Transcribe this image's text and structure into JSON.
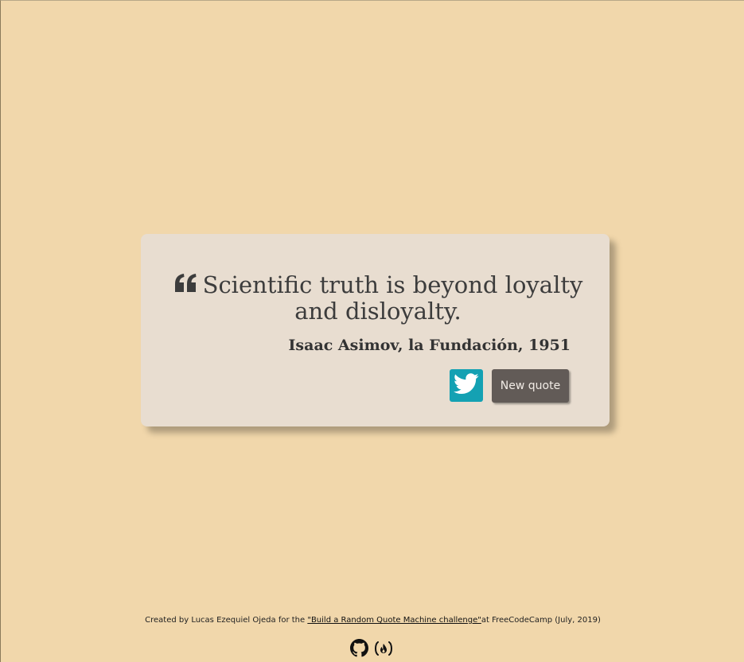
{
  "quote": {
    "text": "Scientific truth is beyond loyalty and disloyalty.",
    "author": "Isaac Asimov, la Fundación, 1951",
    "icon": "quote-left-icon"
  },
  "actions": {
    "tweet_icon": "twitter-icon",
    "new_quote_label": "New quote"
  },
  "footer": {
    "prefix": "Created by Lucas Ezequiel Ojeda for the ",
    "link_text": "\"Build a Random Quote Machine challenge\"",
    "suffix": "at FreeCodeCamp (July, 2019)",
    "icons": [
      "github-icon",
      "freecodecamp-icon"
    ]
  },
  "colors": {
    "background": "#f1d7ab",
    "card": "#e8ddd0",
    "tweet_button": "#14a1b3",
    "new_quote_button": "#625b57",
    "text": "#3c3c3c"
  }
}
